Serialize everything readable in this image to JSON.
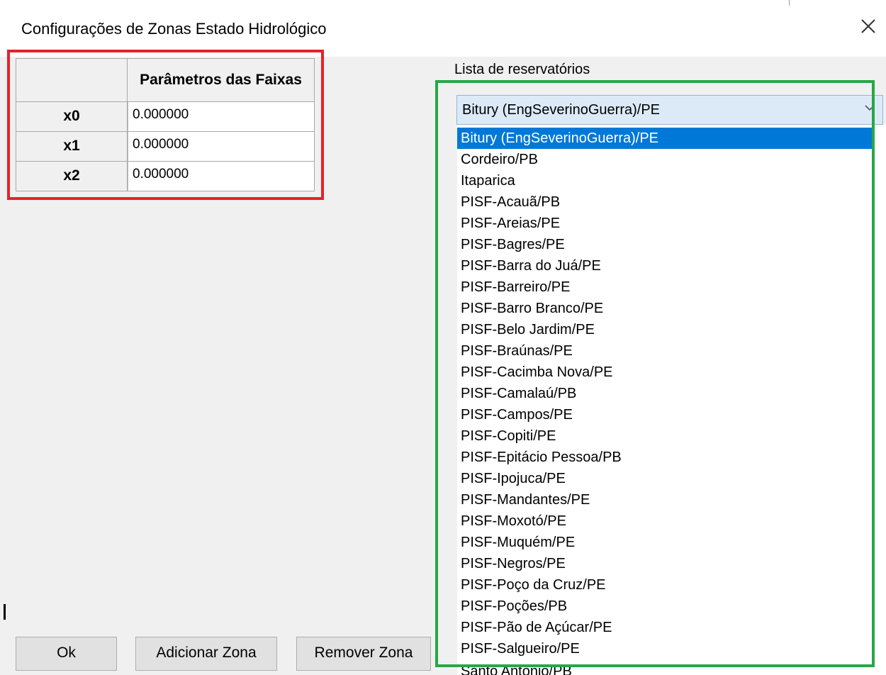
{
  "window": {
    "title": "Configurações de Zonas Estado Hidrológico",
    "close_icon": "close-icon"
  },
  "params_table": {
    "header": "Parâmetros das Faixas",
    "rows": [
      {
        "label": "x0",
        "value": "0.000000"
      },
      {
        "label": "x1",
        "value": "0.000000"
      },
      {
        "label": "x2",
        "value": "0.000000"
      }
    ]
  },
  "buttons": {
    "ok": "Ok",
    "add_zone": "Adicionar Zona",
    "remove_zone": "Remover Zona"
  },
  "reservoirs": {
    "label": "Lista de reservatórios",
    "selected": "Bitury (EngSeverinoGuerra)/PE",
    "dropdown_icon": "chevron-down-icon",
    "options": [
      "Bitury (EngSeverinoGuerra)/PE",
      "Cordeiro/PB",
      "Itaparica",
      "PISF-Acauã/PB",
      "PISF-Areias/PE",
      "PISF-Bagres/PE",
      "PISF-Barra do Juá/PE",
      "PISF-Barreiro/PE",
      "PISF-Barro Branco/PE",
      "PISF-Belo Jardim/PE",
      "PISF-Braúnas/PE",
      "PISF-Cacimba Nova/PE",
      "PISF-Camalaú/PB",
      "PISF-Campos/PE",
      "PISF-Copiti/PE",
      "PISF-Epitácio Pessoa/PB",
      "PISF-Ipojuca/PE",
      "PISF-Mandantes/PE",
      "PISF-Moxotó/PE",
      "PISF-Muquém/PE",
      "PISF-Negros/PE",
      "PISF-Poço da Cruz/PE",
      "PISF-Poções/PB",
      "PISF-Pão de Açúcar/PE",
      "PISF-Salgueiro/PE",
      "Santo Antônio/PB"
    ]
  },
  "colors": {
    "annotation_red": "#e8202a",
    "annotation_green": "#27a745",
    "selection_blue": "#0078d7"
  }
}
